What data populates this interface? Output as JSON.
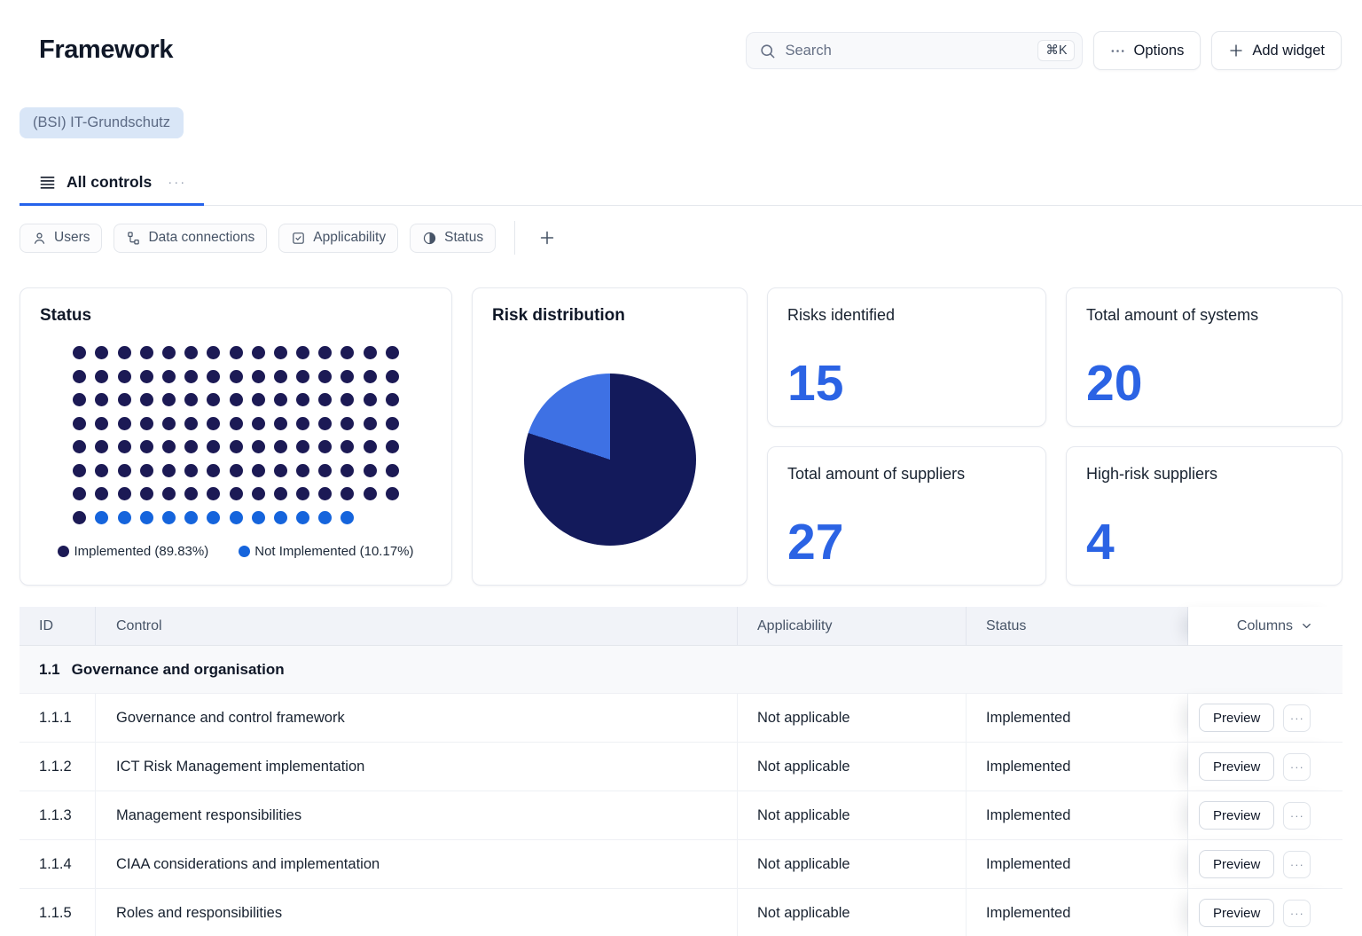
{
  "header": {
    "title": "Framework",
    "search": {
      "placeholder": "Search",
      "shortcut": "⌘K"
    },
    "options_label": "Options",
    "add_widget_label": "Add widget"
  },
  "framework_chip": "(BSI) IT-Grundschutz",
  "tabs": [
    {
      "label": "All controls",
      "active": true
    }
  ],
  "filters": [
    {
      "label": "Users",
      "icon": "user-icon"
    },
    {
      "label": "Data connections",
      "icon": "hierarchy-icon"
    },
    {
      "label": "Applicability",
      "icon": "checkbox-icon"
    },
    {
      "label": "Status",
      "icon": "contrast-icon"
    }
  ],
  "kpis": [
    {
      "label": "Risks identified",
      "value": "15"
    },
    {
      "label": "Total amount of systems",
      "value": "20"
    },
    {
      "label": "Total amount of suppliers",
      "value": "27"
    },
    {
      "label": "High-risk suppliers",
      "value": "4"
    }
  ],
  "chart_data": [
    {
      "type": "dot-matrix",
      "title": "Status",
      "columns": 15,
      "total_dots": 118,
      "series": [
        {
          "name": "Implemented",
          "count": 106,
          "percent": 89.83,
          "color": "#1c1a55"
        },
        {
          "name": "Not Implemented",
          "count": 12,
          "percent": 10.17,
          "color": "#1564dc"
        }
      ],
      "legend": [
        {
          "label": "Implemented (89.83%)",
          "color": "#1c1a55"
        },
        {
          "label": "Not Implemented (10.17%)",
          "color": "#1564dc"
        }
      ],
      "legend_position": "bottom"
    },
    {
      "type": "pie",
      "title": "Risk distribution",
      "slices": [
        {
          "value": 80,
          "color": "#131a5b"
        },
        {
          "value": 20,
          "color": "#3e71e4"
        }
      ],
      "start_angle_deg": 0,
      "legend_position": "none"
    }
  ],
  "table": {
    "columns": [
      "ID",
      "Control",
      "Applicability",
      "Status"
    ],
    "columns_menu_label": "Columns",
    "group": {
      "id": "1.1",
      "label": "Governance and organisation"
    },
    "rows": [
      {
        "id": "1.1.1",
        "control": "Governance and control framework",
        "applicability": "Not applicable",
        "status": "Implemented",
        "action": "Preview"
      },
      {
        "id": "1.1.2",
        "control": "ICT Risk Management implementation",
        "applicability": "Not applicable",
        "status": "Implemented",
        "action": "Preview"
      },
      {
        "id": "1.1.3",
        "control": "Management responsibilities",
        "applicability": "Not applicable",
        "status": "Implemented",
        "action": "Preview"
      },
      {
        "id": "1.1.4",
        "control": "CIAA considerations and implementation",
        "applicability": "Not applicable",
        "status": "Implemented",
        "action": "Preview"
      },
      {
        "id": "1.1.5",
        "control": "Roles and responsibilities",
        "applicability": "Not applicable",
        "status": "Implemented",
        "action": "Preview"
      }
    ]
  },
  "colors": {
    "accent_blue": "#2563eb",
    "kpi_number_blue": "#2b63e4",
    "implemented_navy": "#1c1a55",
    "not_implemented_blue": "#1564dc",
    "pie_navy": "#131a5b",
    "pie_blue": "#3e71e4",
    "chip_bg": "#d9e6f7"
  }
}
